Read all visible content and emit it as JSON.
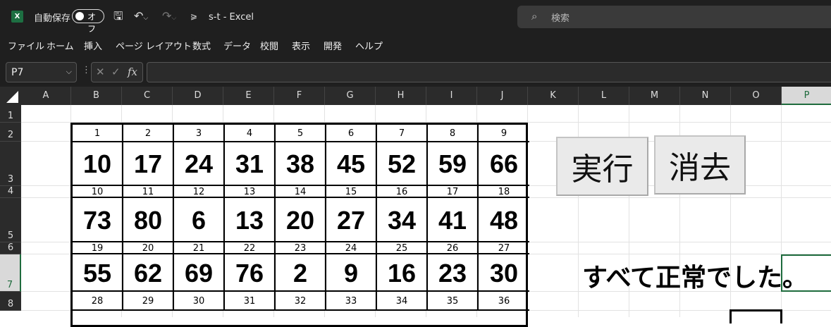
{
  "titlebar": {
    "app_icon": "X",
    "autosave_label": "自動保存",
    "toggle_label": "オフ",
    "save_icon": "save-icon",
    "undo_icon": "undo-icon",
    "redo_icon": "redo-icon",
    "customize_icon": "customize-icon",
    "doc_title": "s-t  -  Excel",
    "search_placeholder": "検索"
  },
  "ribbon_tabs": [
    "ファイル",
    "ホーム",
    "挿入",
    "ページ レイアウト",
    "数式",
    "データ",
    "校閲",
    "表示",
    "開発",
    "ヘルプ"
  ],
  "formula_bar": {
    "name_box": "P7",
    "formula": "",
    "fx": "fx"
  },
  "columns": [
    "A",
    "B",
    "C",
    "D",
    "E",
    "F",
    "G",
    "H",
    "I",
    "J",
    "K",
    "L",
    "M",
    "N",
    "O",
    "P"
  ],
  "rows": [
    "1",
    "2",
    "3",
    "4",
    "5",
    "6",
    "7",
    "8"
  ],
  "selected": {
    "column": "P",
    "row": "7"
  },
  "table": [
    {
      "index": [
        "1",
        "2",
        "3",
        "4",
        "5",
        "6",
        "7",
        "8",
        "9"
      ],
      "values": [
        "10",
        "17",
        "24",
        "31",
        "38",
        "45",
        "52",
        "59",
        "66"
      ]
    },
    {
      "index": [
        "10",
        "11",
        "12",
        "13",
        "14",
        "15",
        "16",
        "17",
        "18"
      ],
      "values": [
        "73",
        "80",
        "6",
        "13",
        "20",
        "27",
        "34",
        "41",
        "48"
      ]
    },
    {
      "index": [
        "19",
        "20",
        "21",
        "22",
        "23",
        "24",
        "25",
        "26",
        "27"
      ],
      "values": [
        "55",
        "62",
        "69",
        "76",
        "2",
        "9",
        "16",
        "23",
        "30"
      ]
    },
    {
      "index": [
        "28",
        "29",
        "30",
        "31",
        "32",
        "33",
        "34",
        "35",
        "36"
      ],
      "values": []
    }
  ],
  "buttons": {
    "run": "実行",
    "clear": "消去"
  },
  "status_text": "すべて正常でした。"
}
